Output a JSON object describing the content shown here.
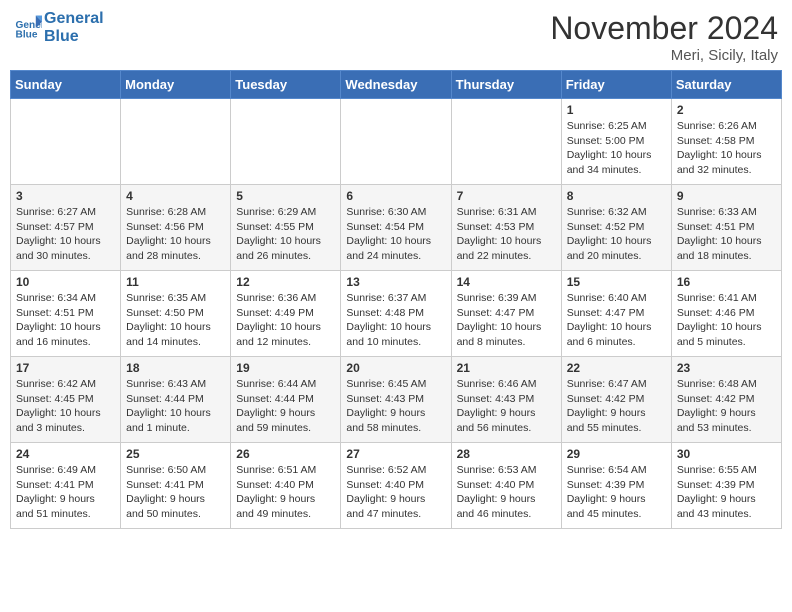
{
  "header": {
    "logo_line1": "General",
    "logo_line2": "Blue",
    "month": "November 2024",
    "location": "Meri, Sicily, Italy"
  },
  "days_of_week": [
    "Sunday",
    "Monday",
    "Tuesday",
    "Wednesday",
    "Thursday",
    "Friday",
    "Saturday"
  ],
  "weeks": [
    [
      {
        "day": "",
        "info": ""
      },
      {
        "day": "",
        "info": ""
      },
      {
        "day": "",
        "info": ""
      },
      {
        "day": "",
        "info": ""
      },
      {
        "day": "",
        "info": ""
      },
      {
        "day": "1",
        "info": "Sunrise: 6:25 AM\nSunset: 5:00 PM\nDaylight: 10 hours\nand 34 minutes."
      },
      {
        "day": "2",
        "info": "Sunrise: 6:26 AM\nSunset: 4:58 PM\nDaylight: 10 hours\nand 32 minutes."
      }
    ],
    [
      {
        "day": "3",
        "info": "Sunrise: 6:27 AM\nSunset: 4:57 PM\nDaylight: 10 hours\nand 30 minutes."
      },
      {
        "day": "4",
        "info": "Sunrise: 6:28 AM\nSunset: 4:56 PM\nDaylight: 10 hours\nand 28 minutes."
      },
      {
        "day": "5",
        "info": "Sunrise: 6:29 AM\nSunset: 4:55 PM\nDaylight: 10 hours\nand 26 minutes."
      },
      {
        "day": "6",
        "info": "Sunrise: 6:30 AM\nSunset: 4:54 PM\nDaylight: 10 hours\nand 24 minutes."
      },
      {
        "day": "7",
        "info": "Sunrise: 6:31 AM\nSunset: 4:53 PM\nDaylight: 10 hours\nand 22 minutes."
      },
      {
        "day": "8",
        "info": "Sunrise: 6:32 AM\nSunset: 4:52 PM\nDaylight: 10 hours\nand 20 minutes."
      },
      {
        "day": "9",
        "info": "Sunrise: 6:33 AM\nSunset: 4:51 PM\nDaylight: 10 hours\nand 18 minutes."
      }
    ],
    [
      {
        "day": "10",
        "info": "Sunrise: 6:34 AM\nSunset: 4:51 PM\nDaylight: 10 hours\nand 16 minutes."
      },
      {
        "day": "11",
        "info": "Sunrise: 6:35 AM\nSunset: 4:50 PM\nDaylight: 10 hours\nand 14 minutes."
      },
      {
        "day": "12",
        "info": "Sunrise: 6:36 AM\nSunset: 4:49 PM\nDaylight: 10 hours\nand 12 minutes."
      },
      {
        "day": "13",
        "info": "Sunrise: 6:37 AM\nSunset: 4:48 PM\nDaylight: 10 hours\nand 10 minutes."
      },
      {
        "day": "14",
        "info": "Sunrise: 6:39 AM\nSunset: 4:47 PM\nDaylight: 10 hours\nand 8 minutes."
      },
      {
        "day": "15",
        "info": "Sunrise: 6:40 AM\nSunset: 4:47 PM\nDaylight: 10 hours\nand 6 minutes."
      },
      {
        "day": "16",
        "info": "Sunrise: 6:41 AM\nSunset: 4:46 PM\nDaylight: 10 hours\nand 5 minutes."
      }
    ],
    [
      {
        "day": "17",
        "info": "Sunrise: 6:42 AM\nSunset: 4:45 PM\nDaylight: 10 hours\nand 3 minutes."
      },
      {
        "day": "18",
        "info": "Sunrise: 6:43 AM\nSunset: 4:44 PM\nDaylight: 10 hours\nand 1 minute."
      },
      {
        "day": "19",
        "info": "Sunrise: 6:44 AM\nSunset: 4:44 PM\nDaylight: 9 hours\nand 59 minutes."
      },
      {
        "day": "20",
        "info": "Sunrise: 6:45 AM\nSunset: 4:43 PM\nDaylight: 9 hours\nand 58 minutes."
      },
      {
        "day": "21",
        "info": "Sunrise: 6:46 AM\nSunset: 4:43 PM\nDaylight: 9 hours\nand 56 minutes."
      },
      {
        "day": "22",
        "info": "Sunrise: 6:47 AM\nSunset: 4:42 PM\nDaylight: 9 hours\nand 55 minutes."
      },
      {
        "day": "23",
        "info": "Sunrise: 6:48 AM\nSunset: 4:42 PM\nDaylight: 9 hours\nand 53 minutes."
      }
    ],
    [
      {
        "day": "24",
        "info": "Sunrise: 6:49 AM\nSunset: 4:41 PM\nDaylight: 9 hours\nand 51 minutes."
      },
      {
        "day": "25",
        "info": "Sunrise: 6:50 AM\nSunset: 4:41 PM\nDaylight: 9 hours\nand 50 minutes."
      },
      {
        "day": "26",
        "info": "Sunrise: 6:51 AM\nSunset: 4:40 PM\nDaylight: 9 hours\nand 49 minutes."
      },
      {
        "day": "27",
        "info": "Sunrise: 6:52 AM\nSunset: 4:40 PM\nDaylight: 9 hours\nand 47 minutes."
      },
      {
        "day": "28",
        "info": "Sunrise: 6:53 AM\nSunset: 4:40 PM\nDaylight: 9 hours\nand 46 minutes."
      },
      {
        "day": "29",
        "info": "Sunrise: 6:54 AM\nSunset: 4:39 PM\nDaylight: 9 hours\nand 45 minutes."
      },
      {
        "day": "30",
        "info": "Sunrise: 6:55 AM\nSunset: 4:39 PM\nDaylight: 9 hours\nand 43 minutes."
      }
    ]
  ]
}
